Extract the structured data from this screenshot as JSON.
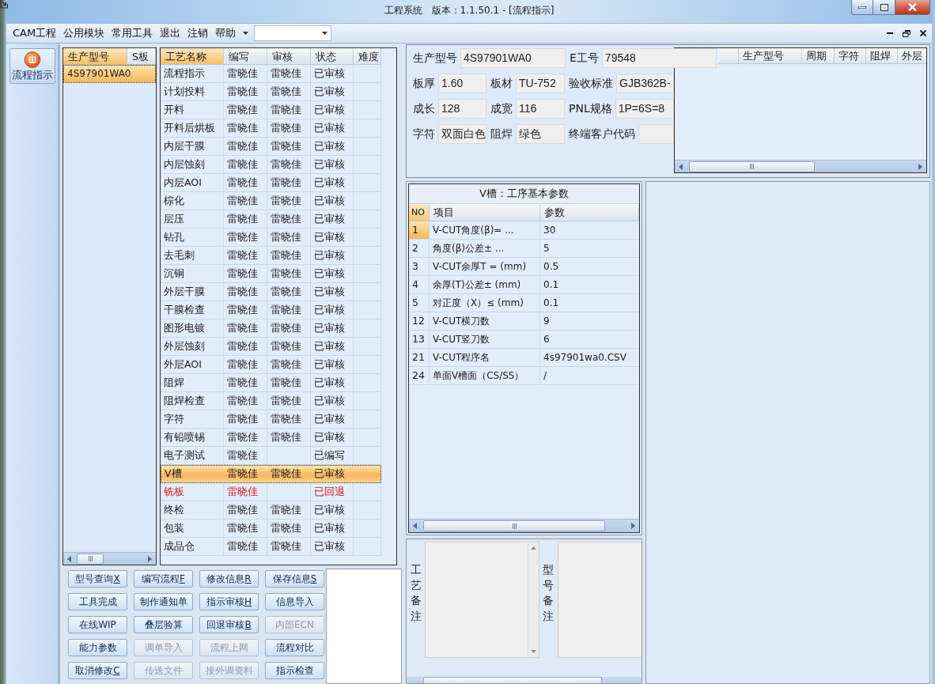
{
  "window": {
    "title": "工程系统　版本：1.1.50.1 - [流程指示]"
  },
  "menu": {
    "items": [
      "CAM工程",
      "公用模块",
      "常用工具",
      "退出",
      "注销",
      "帮助"
    ]
  },
  "nav": {
    "items": [
      {
        "label": "流程指示"
      }
    ]
  },
  "model_list": {
    "columns": [
      {
        "label": "生产型号",
        "selected": true
      },
      {
        "label": "S板",
        "selected": false
      }
    ],
    "rows": [
      {
        "model": "4S97901WA0",
        "selected": true
      }
    ]
  },
  "process_table": {
    "columns": [
      {
        "label": "工艺名称",
        "selected": true
      },
      {
        "label": "编写",
        "selected": false
      },
      {
        "label": "审核",
        "selected": false
      },
      {
        "label": "状态",
        "selected": false
      },
      {
        "label": "难度",
        "selected": false
      }
    ],
    "rows": [
      {
        "name": "流程指示",
        "writer": "雷晓佳",
        "reviewer": "雷晓佳",
        "status": "已审核",
        "selected": false,
        "returned": false
      },
      {
        "name": "计划投料",
        "writer": "雷晓佳",
        "reviewer": "雷晓佳",
        "status": "已审核",
        "selected": false,
        "returned": false
      },
      {
        "name": "开料",
        "writer": "雷晓佳",
        "reviewer": "雷晓佳",
        "status": "已审核",
        "selected": false,
        "returned": false
      },
      {
        "name": "开料后烘板",
        "writer": "雷晓佳",
        "reviewer": "雷晓佳",
        "status": "已审核",
        "selected": false,
        "returned": false
      },
      {
        "name": "内层干膜",
        "writer": "雷晓佳",
        "reviewer": "雷晓佳",
        "status": "已审核",
        "selected": false,
        "returned": false
      },
      {
        "name": "内层蚀刻",
        "writer": "雷晓佳",
        "reviewer": "雷晓佳",
        "status": "已审核",
        "selected": false,
        "returned": false
      },
      {
        "name": "内层AOI",
        "writer": "雷晓佳",
        "reviewer": "雷晓佳",
        "status": "已审核",
        "selected": false,
        "returned": false
      },
      {
        "name": "棕化",
        "writer": "雷晓佳",
        "reviewer": "雷晓佳",
        "status": "已审核",
        "selected": false,
        "returned": false
      },
      {
        "name": "层压",
        "writer": "雷晓佳",
        "reviewer": "雷晓佳",
        "status": "已审核",
        "selected": false,
        "returned": false
      },
      {
        "name": "钻孔",
        "writer": "雷晓佳",
        "reviewer": "雷晓佳",
        "status": "已审核",
        "selected": false,
        "returned": false
      },
      {
        "name": "去毛刺",
        "writer": "雷晓佳",
        "reviewer": "雷晓佳",
        "status": "已审核",
        "selected": false,
        "returned": false
      },
      {
        "name": "沉铜",
        "writer": "雷晓佳",
        "reviewer": "雷晓佳",
        "status": "已审核",
        "selected": false,
        "returned": false
      },
      {
        "name": "外层干膜",
        "writer": "雷晓佳",
        "reviewer": "雷晓佳",
        "status": "已审核",
        "selected": false,
        "returned": false
      },
      {
        "name": "干膜检查",
        "writer": "雷晓佳",
        "reviewer": "雷晓佳",
        "status": "已审核",
        "selected": false,
        "returned": false
      },
      {
        "name": "图形电镀",
        "writer": "雷晓佳",
        "reviewer": "雷晓佳",
        "status": "已审核",
        "selected": false,
        "returned": false
      },
      {
        "name": "外层蚀刻",
        "writer": "雷晓佳",
        "reviewer": "雷晓佳",
        "status": "已审核",
        "selected": false,
        "returned": false
      },
      {
        "name": "外层AOI",
        "writer": "雷晓佳",
        "reviewer": "雷晓佳",
        "status": "已审核",
        "selected": false,
        "returned": false
      },
      {
        "name": "阻焊",
        "writer": "雷晓佳",
        "reviewer": "雷晓佳",
        "status": "已审核",
        "selected": false,
        "returned": false
      },
      {
        "name": "阻焊检查",
        "writer": "雷晓佳",
        "reviewer": "雷晓佳",
        "status": "已审核",
        "selected": false,
        "returned": false
      },
      {
        "name": "字符",
        "writer": "雷晓佳",
        "reviewer": "雷晓佳",
        "status": "已审核",
        "selected": false,
        "returned": false
      },
      {
        "name": "有铅喷锡",
        "writer": "雷晓佳",
        "reviewer": "雷晓佳",
        "status": "已审核",
        "selected": false,
        "returned": false
      },
      {
        "name": "电子测试",
        "writer": "雷晓佳",
        "status": "已编写",
        "selected": false,
        "returned": false
      },
      {
        "name": "V槽",
        "writer": "雷晓佳",
        "reviewer": "雷晓佳",
        "status": "已审核",
        "selected": true,
        "returned": false
      },
      {
        "name": "铣板",
        "writer": "雷晓佳",
        "status": "已回退",
        "selected": false,
        "returned": true
      },
      {
        "name": "终检",
        "writer": "雷晓佳",
        "reviewer": "雷晓佳",
        "status": "已审核",
        "selected": false,
        "returned": false
      },
      {
        "name": "包装",
        "writer": "雷晓佳",
        "reviewer": "雷晓佳",
        "status": "已审核",
        "selected": false,
        "returned": false
      },
      {
        "name": "成品仓",
        "writer": "雷晓佳",
        "reviewer": "雷晓佳",
        "status": "已审核",
        "selected": false,
        "returned": false
      }
    ]
  },
  "buttons": [
    {
      "label": "型号查询",
      "key": "X",
      "disabled": false
    },
    {
      "label": "编写流程",
      "key": "F",
      "disabled": false
    },
    {
      "label": "修改信息",
      "key": "R",
      "disabled": false
    },
    {
      "label": "保存信息",
      "key": "S",
      "disabled": false
    },
    {
      "label": "工具完成",
      "disabled": false
    },
    {
      "label": "制作通知单",
      "disabled": false
    },
    {
      "label": "指示审核",
      "key": "H",
      "disabled": false
    },
    {
      "label": "信息导入",
      "disabled": false
    },
    {
      "label": "在线WIP",
      "disabled": false
    },
    {
      "label": "叠层验算",
      "disabled": false
    },
    {
      "label": "回退审核",
      "key": "B",
      "disabled": false
    },
    {
      "label": "内部ECN",
      "disabled": true
    },
    {
      "label": "能力参数",
      "disabled": false
    },
    {
      "label": "调单导入",
      "disabled": true
    },
    {
      "label": "流程上网",
      "disabled": true
    },
    {
      "label": "流程对比",
      "disabled": false
    },
    {
      "label": "取消修改",
      "key": "C",
      "disabled": false
    },
    {
      "label": "传送文件",
      "disabled": true
    },
    {
      "label": "接外调资料",
      "disabled": true
    },
    {
      "label": "指示检查",
      "disabled": false
    }
  ],
  "info_form": {
    "fields": [
      {
        "label": "生产型号",
        "value": "4S97901WA0"
      },
      {
        "label": "E工号",
        "value": "79548"
      },
      {
        "label": "板厚",
        "value": "1.60"
      },
      {
        "label": "板材",
        "value": "TU-752"
      },
      {
        "label": "验收标准",
        "value": "GJB362B-"
      },
      {
        "label": "成长",
        "value": "128"
      },
      {
        "label": "成宽",
        "value": "116"
      },
      {
        "label": "PNL规格",
        "value": "1P=6S=8"
      },
      {
        "label": "字符",
        "value": "双面白色"
      },
      {
        "label": "阻焊",
        "value": "绿色"
      },
      {
        "label": "终端客户代码"
      }
    ]
  },
  "summary_grid": {
    "columns": [
      "生产型号",
      "周期",
      "字符",
      "阻焊",
      "外层"
    ]
  },
  "params_table": {
    "title": "V槽：工序基本参数",
    "columns": [
      "NO",
      "项目",
      "参数"
    ],
    "rows": [
      {
        "no": "1",
        "item": "V-CUT角度(β)=  ...",
        "value": "30",
        "selected": true
      },
      {
        "no": "2",
        "item": "角度(β)公差±  ...",
        "value": "5",
        "selected": false
      },
      {
        "no": "3",
        "item": "V-CUT余厚T =  (mm)",
        "value": "0.5",
        "selected": false
      },
      {
        "no": "4",
        "item": "余厚(T)公差±  (mm)",
        "value": "0.1",
        "selected": false
      },
      {
        "no": "5",
        "item": "对正度（X）≤ (mm)",
        "value": "0.1",
        "selected": false
      },
      {
        "no": "12",
        "item": "V-CUT横刀数",
        "value": "9",
        "selected": false
      },
      {
        "no": "13",
        "item": "V-CUT竖刀数",
        "value": "6",
        "selected": false
      },
      {
        "no": "21",
        "item": "V-CUT程序名",
        "value": "4s97901wa0.CSV",
        "selected": false
      },
      {
        "no": "24",
        "item": "单面V槽面（CS/SS）",
        "value": "/",
        "selected": false
      }
    ]
  },
  "remarks": [
    {
      "label": "工艺备注"
    },
    {
      "label": "型号备注"
    }
  ]
}
